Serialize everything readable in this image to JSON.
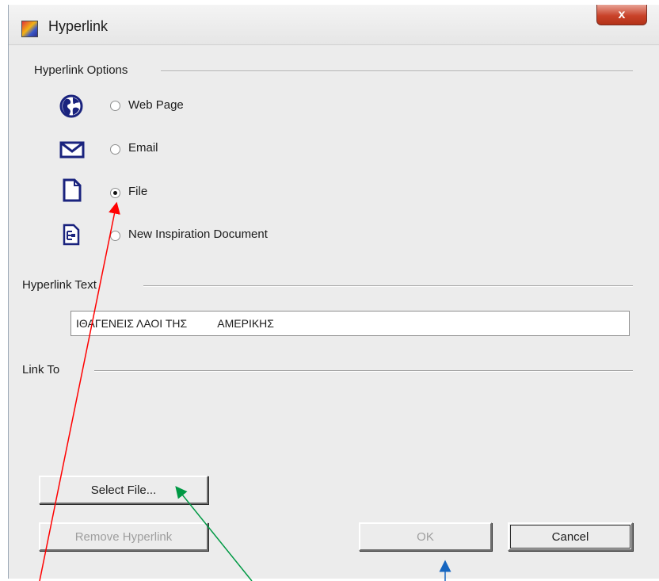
{
  "window": {
    "title": "Hyperlink",
    "close_label": "x"
  },
  "options_group": {
    "label": "Hyperlink Options",
    "items": [
      {
        "label": "Web Page",
        "icon": "globe-icon",
        "selected": false
      },
      {
        "label": "Email",
        "icon": "envelope-icon",
        "selected": false
      },
      {
        "label": "File",
        "icon": "file-icon",
        "selected": true
      },
      {
        "label": "New Inspiration Document",
        "icon": "inspiration-document-icon",
        "selected": false
      }
    ]
  },
  "text_group": {
    "label": "Hyperlink Text",
    "value": "ΙΘΑΓΕΝΕΙΣ ΛΑΟΙ ΤΗΣ          ΑΜΕΡΙΚΗΣ"
  },
  "link_group": {
    "label": "Link To"
  },
  "buttons": {
    "select_file": "Select File...",
    "remove_hyperlink": "Remove Hyperlink",
    "ok": "OK",
    "cancel": "Cancel"
  },
  "colors": {
    "icon_blue": "#1a237e",
    "annotation_red": "#ff0000",
    "annotation_green": "#009944",
    "annotation_blue": "#1565c0"
  }
}
